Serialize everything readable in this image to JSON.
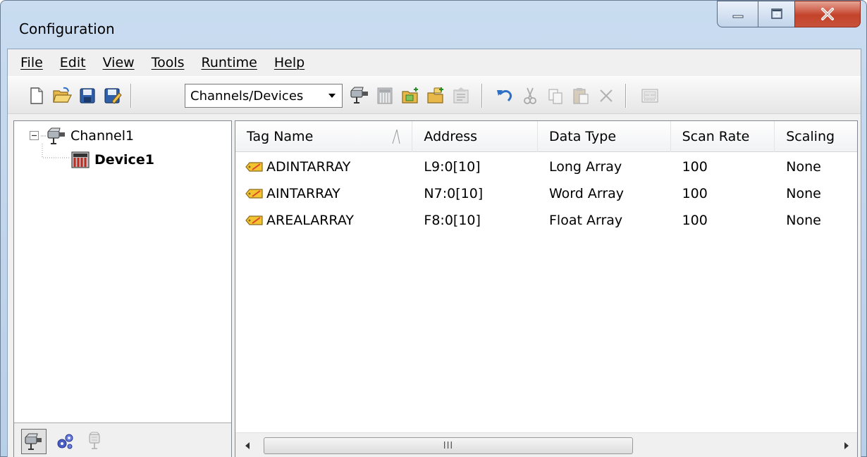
{
  "window": {
    "title": "Configuration"
  },
  "menu": [
    {
      "label": "File"
    },
    {
      "label": "Edit"
    },
    {
      "label": "View"
    },
    {
      "label": "Tools"
    },
    {
      "label": "Runtime"
    },
    {
      "label": "Help"
    }
  ],
  "toolbar": {
    "view_select": "Channels/Devices",
    "icons": [
      "new-icon",
      "open-icon",
      "save-icon",
      "save-as-icon",
      "new-channel-icon",
      "new-device-icon",
      "new-tag-icon",
      "new-tag-group-icon",
      "properties-icon",
      "undo-icon",
      "cut-icon",
      "copy-icon",
      "paste-icon",
      "delete-icon",
      "quick-client-icon"
    ]
  },
  "tree": {
    "channel": "Channel1",
    "device": "Device1"
  },
  "list": {
    "columns": [
      "Tag Name",
      "Address",
      "Data Type",
      "Scan Rate",
      "Scaling"
    ],
    "rows": [
      [
        "ADINTARRAY",
        "L9:0[10]",
        "Long Array",
        "100",
        "None"
      ],
      [
        "AINTARRAY",
        "N7:0[10]",
        "Word Array",
        "100",
        "None"
      ],
      [
        "AREALARRAY",
        "F8:0[10]",
        "Float Array",
        "100",
        "None"
      ]
    ],
    "scroll_thumb_label": "III"
  },
  "colors": {
    "title_gradient_top": "#c9dcf0",
    "close_red": "#c4422a",
    "tag_icon_yellow": "#f4c430"
  }
}
